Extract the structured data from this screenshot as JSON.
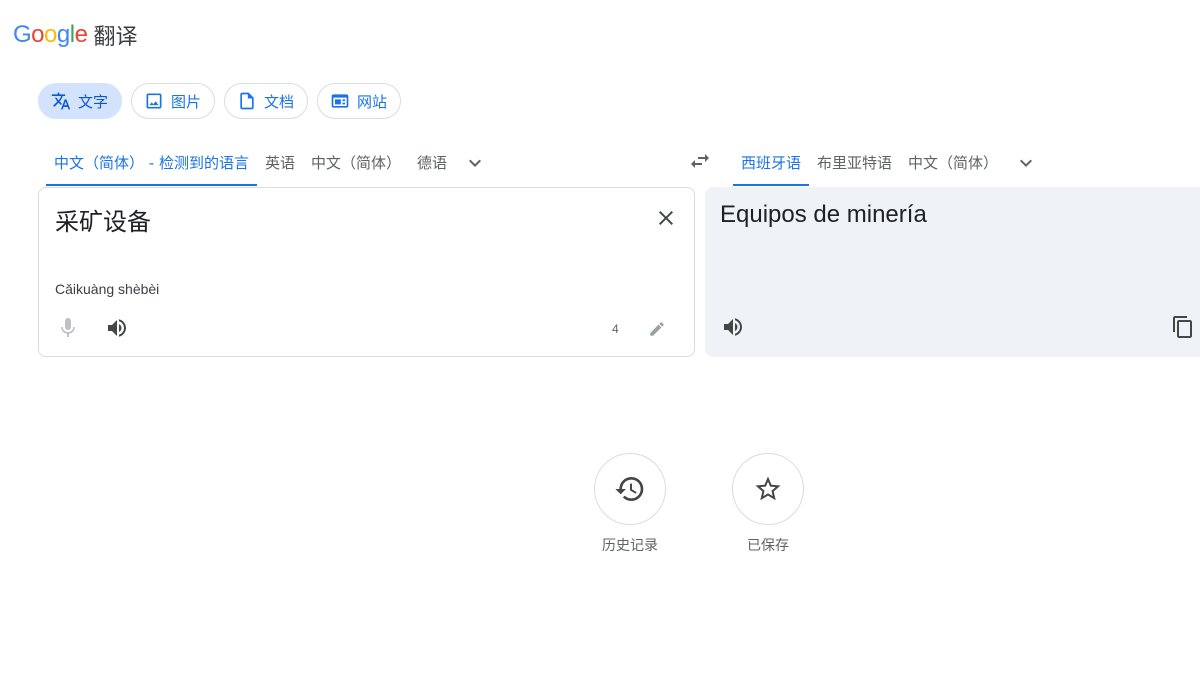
{
  "header": {
    "logo_text": "Google",
    "product_title": "翻译"
  },
  "modes": [
    {
      "label": "文字",
      "icon": "translate-icon",
      "active": true
    },
    {
      "label": "图片",
      "icon": "image-icon",
      "active": false
    },
    {
      "label": "文档",
      "icon": "document-icon",
      "active": false
    },
    {
      "label": "网站",
      "icon": "website-icon",
      "active": false
    }
  ],
  "source_languages": {
    "tabs": [
      "中文（简体） - 检测到的语言",
      "英语",
      "中文（简体）",
      "德语"
    ],
    "active_index": 0
  },
  "target_languages": {
    "tabs": [
      "西班牙语",
      "布里亚特语",
      "中文（简体）"
    ],
    "active_index": 0
  },
  "source": {
    "text": "采矿设备",
    "transliteration": "Cǎikuàng shèbèi",
    "char_count": "4"
  },
  "target": {
    "text": "Equipos de minería"
  },
  "bottom_actions": [
    {
      "label": "历史记录",
      "icon": "history-icon"
    },
    {
      "label": "已保存",
      "icon": "star-icon"
    }
  ],
  "colors": {
    "accent": "#1a73e8",
    "active_mode_bg": "#d3e3fd",
    "target_panel_bg": "#eff3f8",
    "icon_gray": "#5f6368"
  }
}
